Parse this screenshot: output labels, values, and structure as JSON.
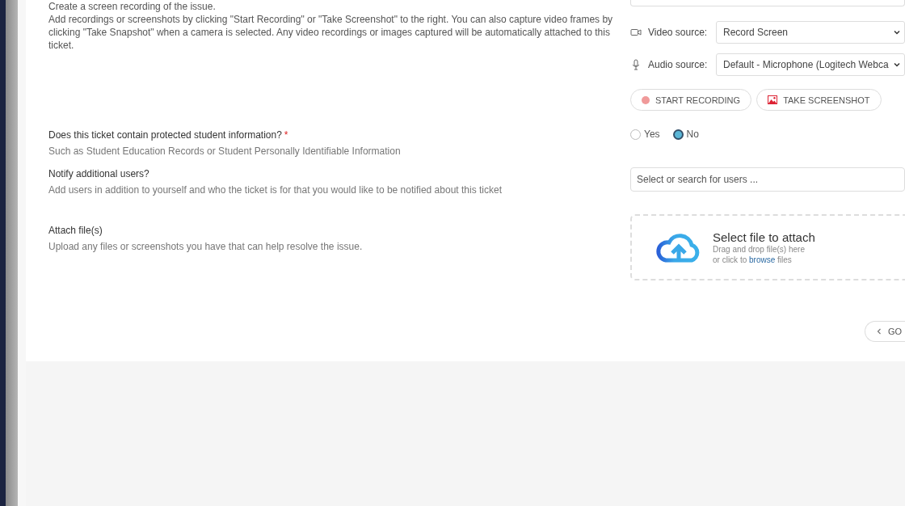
{
  "intro": {
    "cut_line": "Create a screen recording of the issue.",
    "text": "Add recordings or screenshots by clicking \"Start Recording\" or \"Take Screenshot\" to the right.  You can also capture video frames by clicking \"Take Snapshot\" when a camera is selected.  Any video recordings or images captured will be automatically attached to this ticket."
  },
  "recording": {
    "video_label": "Video source:",
    "video_value": "Record Screen",
    "audio_label": "Audio source:",
    "audio_value": "Default - Microphone (Logitech Webca",
    "buttons": [
      {
        "label": "START RECORDING",
        "kind": "record"
      },
      {
        "label": "TAKE SCREENSHOT",
        "kind": "screenshot"
      }
    ]
  },
  "protected": {
    "label": "Does this ticket contain protected student information?",
    "required_mark": "*",
    "hint": "Such as Student Education Records or Student Personally Identifiable Information",
    "options": [
      {
        "label": "Yes",
        "selected": false
      },
      {
        "label": "No",
        "selected": true
      }
    ]
  },
  "notify": {
    "label": "Notify additional users?",
    "hint": "Add users in addition to yourself and who the ticket is for that you would like to be notified about this ticket",
    "placeholder": "Select or search for users ..."
  },
  "attach": {
    "label": "Attach file(s)",
    "hint": "Upload any files or screenshots you have that can help resolve the issue.",
    "title": "Select file to attach",
    "line1": "Drag and drop file(s) here",
    "line2_before": "or click to",
    "link": "browse",
    "line2_after": "files"
  },
  "back_button": {
    "label": "GO"
  }
}
